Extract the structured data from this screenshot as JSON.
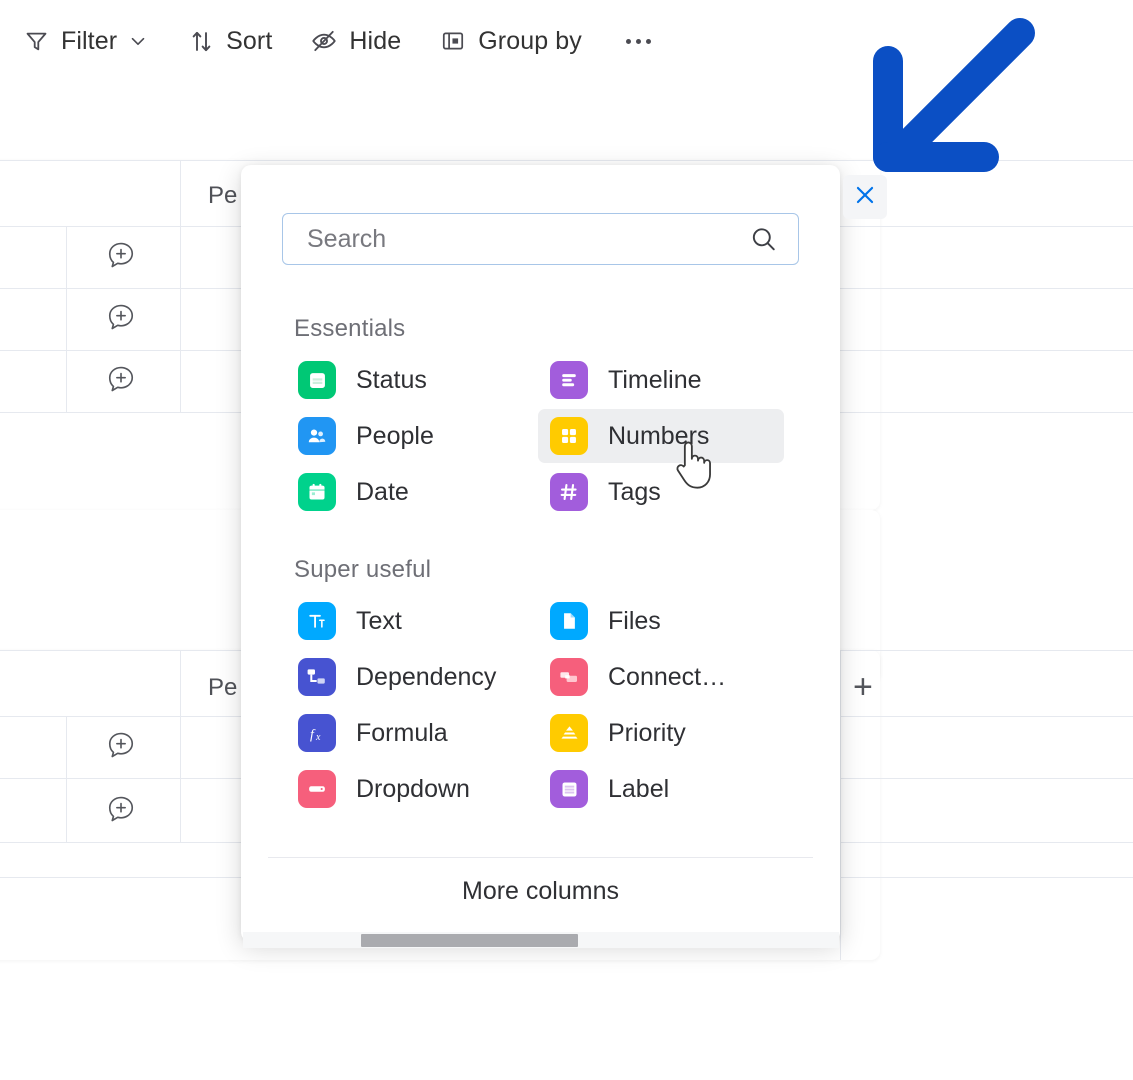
{
  "toolbar": {
    "items": [
      {
        "label": "Filter",
        "icon": "filter-icon",
        "has_chevron": true
      },
      {
        "label": "Sort",
        "icon": "sort-icon",
        "has_chevron": false
      },
      {
        "label": "Hide",
        "icon": "eye-slash-icon",
        "has_chevron": false
      },
      {
        "label": "Group by",
        "icon": "group-by-icon",
        "has_chevron": false
      }
    ],
    "overflow_icon": "ellipsis-icon"
  },
  "board": {
    "column_header_partial_top": "Pe",
    "column_header_partial_bottom": "Pe",
    "add_column_button": "+",
    "row_icon": "chat-add-icon"
  },
  "panel": {
    "search": {
      "placeholder": "Search",
      "value": "",
      "icon": "search-icon"
    },
    "sections": [
      {
        "title": "Essentials",
        "left_items": [
          {
            "label": "Status",
            "icon": "status-icon",
            "color": "#00c875",
            "hover": false
          },
          {
            "label": "People",
            "icon": "people-icon",
            "color": "#2196f3",
            "hover": false
          },
          {
            "label": "Date",
            "icon": "date-icon",
            "color": "#00d28c",
            "hover": false
          }
        ],
        "right_items": [
          {
            "label": "Timeline",
            "icon": "timeline-icon",
            "color": "#a25ddc",
            "hover": false
          },
          {
            "label": "Numbers",
            "icon": "numbers-icon",
            "color": "#ffcb00",
            "hover": true
          },
          {
            "label": "Tags",
            "icon": "tags-icon",
            "color": "#a25ddc",
            "hover": false
          }
        ]
      },
      {
        "title": "Super useful",
        "left_items": [
          {
            "label": "Text",
            "icon": "text-icon",
            "color": "#00a9ff",
            "hover": false
          },
          {
            "label": "Dependency",
            "icon": "dependency-icon",
            "color": "#4753d1",
            "hover": false
          },
          {
            "label": "Formula",
            "icon": "formula-icon",
            "color": "#4753d1",
            "hover": false
          },
          {
            "label": "Dropdown",
            "icon": "dropdown-icon",
            "color": "#f65f7c",
            "hover": false
          }
        ],
        "right_items": [
          {
            "label": "Files",
            "icon": "files-icon",
            "color": "#00a9ff",
            "hover": false
          },
          {
            "label": "Connect…",
            "icon": "connect-icon",
            "color": "#f65f7c",
            "hover": false
          },
          {
            "label": "Priority",
            "icon": "priority-icon",
            "color": "#ffcb00",
            "hover": false
          },
          {
            "label": "Label",
            "icon": "label-icon",
            "color": "#a25ddc",
            "hover": false
          }
        ]
      }
    ],
    "footer": {
      "more_columns_label": "More columns"
    },
    "close_button_icon": "close-icon"
  },
  "annotation": {
    "arrow_icon": "arrow-down-left-icon",
    "arrow_color": "#0b4fc4"
  },
  "cursor": {
    "icon": "pointing-hand-cursor"
  },
  "colors": {
    "accent_blue": "#0073ea",
    "annotation_blue": "#0b4fc4",
    "hover_gray": "#edeef0",
    "grid_line": "#e6e9ef",
    "text_primary": "#2f3034",
    "text_secondary": "#6e6f76"
  }
}
